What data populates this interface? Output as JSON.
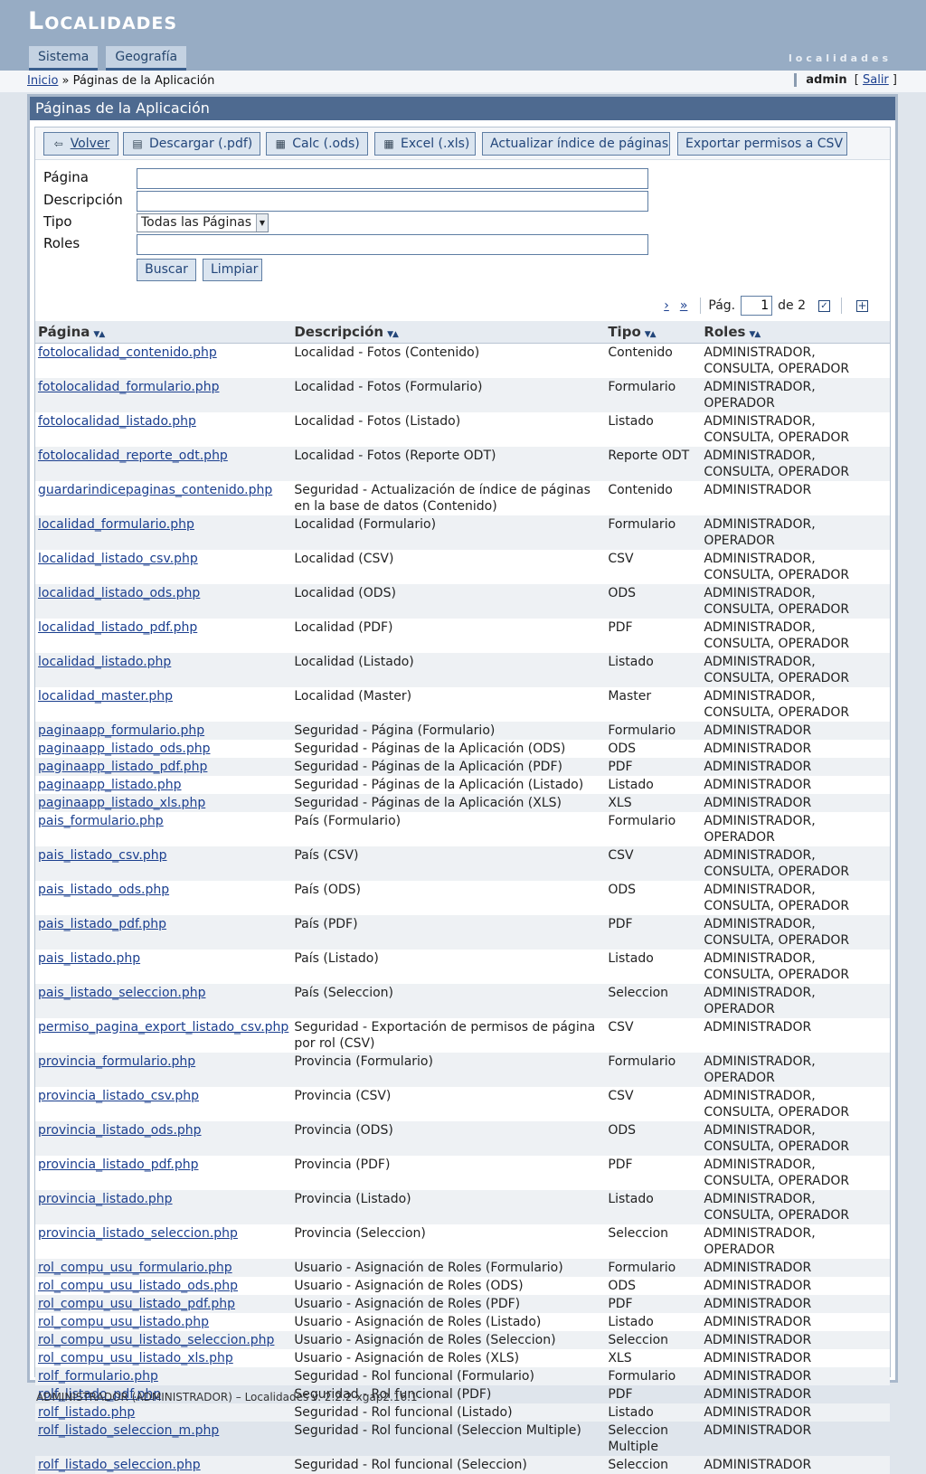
{
  "app": {
    "title": "Localidades",
    "tagline": "localidades"
  },
  "menu": {
    "tabs": [
      "Sistema",
      "Geografía"
    ]
  },
  "breadcrumb": {
    "home": "Inicio",
    "separator": "»",
    "current": "Páginas de la Aplicación"
  },
  "user": {
    "name": "admin",
    "logout": "Salir",
    "open": "[",
    "close": "]"
  },
  "panel": {
    "title": "Páginas de la Aplicación"
  },
  "toolbar": {
    "volver": "Volver",
    "pdf": "Descargar (.pdf)",
    "ods": "Calc (.ods)",
    "xls": "Excel (.xls)",
    "reindex": "Actualizar índice de páginas",
    "export": "Exportar permisos a CSV"
  },
  "form": {
    "pagina_label": "Página",
    "descripcion_label": "Descripción",
    "tipo_label": "Tipo",
    "roles_label": "Roles",
    "tipo_selected": "Todas las Páginas",
    "buscar": "Buscar",
    "limpiar": "Limpiar"
  },
  "pager": {
    "next": "›",
    "last": "»",
    "label": "Pág.",
    "current": "1",
    "of": "de 2"
  },
  "table": {
    "headers": [
      "Página",
      "Descripción",
      "Tipo",
      "Roles"
    ],
    "rows": [
      [
        "fotolocalidad_contenido.php",
        "Localidad - Fotos (Contenido)",
        "Contenido",
        "ADMINISTRADOR, CONSULTA, OPERADOR"
      ],
      [
        "fotolocalidad_formulario.php",
        "Localidad - Fotos (Formulario)",
        "Formulario",
        "ADMINISTRADOR, OPERADOR"
      ],
      [
        "fotolocalidad_listado.php",
        "Localidad - Fotos (Listado)",
        "Listado",
        "ADMINISTRADOR, CONSULTA, OPERADOR"
      ],
      [
        "fotolocalidad_reporte_odt.php",
        "Localidad - Fotos (Reporte ODT)",
        "Reporte ODT",
        "ADMINISTRADOR, CONSULTA, OPERADOR"
      ],
      [
        "guardarindicepaginas_contenido.php",
        "Seguridad - Actualización de índice de páginas en la base de datos (Contenido)",
        "Contenido",
        "ADMINISTRADOR"
      ],
      [
        "localidad_formulario.php",
        "Localidad (Formulario)",
        "Formulario",
        "ADMINISTRADOR, OPERADOR"
      ],
      [
        "localidad_listado_csv.php",
        "Localidad (CSV)",
        "CSV",
        "ADMINISTRADOR, CONSULTA, OPERADOR"
      ],
      [
        "localidad_listado_ods.php",
        "Localidad (ODS)",
        "ODS",
        "ADMINISTRADOR, CONSULTA, OPERADOR"
      ],
      [
        "localidad_listado_pdf.php",
        "Localidad (PDF)",
        "PDF",
        "ADMINISTRADOR, CONSULTA, OPERADOR"
      ],
      [
        "localidad_listado.php",
        "Localidad (Listado)",
        "Listado",
        "ADMINISTRADOR, CONSULTA, OPERADOR"
      ],
      [
        "localidad_master.php",
        "Localidad (Master)",
        "Master",
        "ADMINISTRADOR, CONSULTA, OPERADOR"
      ],
      [
        "paginaapp_formulario.php",
        "Seguridad - Página (Formulario)",
        "Formulario",
        "ADMINISTRADOR"
      ],
      [
        "paginaapp_listado_ods.php",
        "Seguridad - Páginas de la Aplicación (ODS)",
        "ODS",
        "ADMINISTRADOR"
      ],
      [
        "paginaapp_listado_pdf.php",
        "Seguridad - Páginas de la Aplicación (PDF)",
        "PDF",
        "ADMINISTRADOR"
      ],
      [
        "paginaapp_listado.php",
        "Seguridad - Páginas de la Aplicación (Listado)",
        "Listado",
        "ADMINISTRADOR"
      ],
      [
        "paginaapp_listado_xls.php",
        "Seguridad - Páginas de la Aplicación (XLS)",
        "XLS",
        "ADMINISTRADOR"
      ],
      [
        "pais_formulario.php",
        "País (Formulario)",
        "Formulario",
        "ADMINISTRADOR, OPERADOR"
      ],
      [
        "pais_listado_csv.php",
        "País (CSV)",
        "CSV",
        "ADMINISTRADOR, CONSULTA, OPERADOR"
      ],
      [
        "pais_listado_ods.php",
        "País (ODS)",
        "ODS",
        "ADMINISTRADOR, CONSULTA, OPERADOR"
      ],
      [
        "pais_listado_pdf.php",
        "País (PDF)",
        "PDF",
        "ADMINISTRADOR, CONSULTA, OPERADOR"
      ],
      [
        "pais_listado.php",
        "País (Listado)",
        "Listado",
        "ADMINISTRADOR, CONSULTA, OPERADOR"
      ],
      [
        "pais_listado_seleccion.php",
        "País (Seleccion)",
        "Seleccion",
        "ADMINISTRADOR, OPERADOR"
      ],
      [
        "permiso_pagina_export_listado_csv.php",
        "Seguridad - Exportación de permisos de página por rol (CSV)",
        "CSV",
        "ADMINISTRADOR"
      ],
      [
        "provincia_formulario.php",
        "Provincia (Formulario)",
        "Formulario",
        "ADMINISTRADOR, OPERADOR"
      ],
      [
        "provincia_listado_csv.php",
        "Provincia (CSV)",
        "CSV",
        "ADMINISTRADOR, CONSULTA, OPERADOR"
      ],
      [
        "provincia_listado_ods.php",
        "Provincia (ODS)",
        "ODS",
        "ADMINISTRADOR, CONSULTA, OPERADOR"
      ],
      [
        "provincia_listado_pdf.php",
        "Provincia (PDF)",
        "PDF",
        "ADMINISTRADOR, CONSULTA, OPERADOR"
      ],
      [
        "provincia_listado.php",
        "Provincia (Listado)",
        "Listado",
        "ADMINISTRADOR, CONSULTA, OPERADOR"
      ],
      [
        "provincia_listado_seleccion.php",
        "Provincia (Seleccion)",
        "Seleccion",
        "ADMINISTRADOR, OPERADOR"
      ],
      [
        "rol_compu_usu_formulario.php",
        "Usuario - Asignación de Roles (Formulario)",
        "Formulario",
        "ADMINISTRADOR"
      ],
      [
        "rol_compu_usu_listado_ods.php",
        "Usuario - Asignación de Roles (ODS)",
        "ODS",
        "ADMINISTRADOR"
      ],
      [
        "rol_compu_usu_listado_pdf.php",
        "Usuario - Asignación de Roles (PDF)",
        "PDF",
        "ADMINISTRADOR"
      ],
      [
        "rol_compu_usu_listado.php",
        "Usuario - Asignación de Roles (Listado)",
        "Listado",
        "ADMINISTRADOR"
      ],
      [
        "rol_compu_usu_listado_seleccion.php",
        "Usuario - Asignación de Roles (Seleccion)",
        "Seleccion",
        "ADMINISTRADOR"
      ],
      [
        "rol_compu_usu_listado_xls.php",
        "Usuario - Asignación de Roles (XLS)",
        "XLS",
        "ADMINISTRADOR"
      ],
      [
        "rolf_formulario.php",
        "Seguridad - Rol funcional (Formulario)",
        "Formulario",
        "ADMINISTRADOR"
      ],
      [
        "rolf_listado_pdf.php",
        "Seguridad - Rol funcional (PDF)",
        "PDF",
        "ADMINISTRADOR"
      ],
      [
        "rolf_listado.php",
        "Seguridad - Rol funcional (Listado)",
        "Listado",
        "ADMINISTRADOR"
      ],
      [
        "rolf_listado_seleccion_m.php",
        "Seguridad - Rol funcional (Seleccion Multiple)",
        "Seleccion Multiple",
        "ADMINISTRADOR"
      ],
      [
        "rolf_listado_seleccion.php",
        "Seguridad - Rol funcional (Seleccion)",
        "Seleccion",
        "ADMINISTRADOR"
      ]
    ]
  },
  "footer": {
    "text": "ADMINISTRADOR (ADMINISTRADOR)  –  Localidades v. 2.2.2-xgap2.16.1"
  },
  "icons": {
    "volver": "back-arrow-icon",
    "pdf": "document-icon",
    "ods": "spreadsheet-icon",
    "xls": "spreadsheet-icon",
    "sort": "sort-arrows-icon",
    "select_all": "checkbox-icon",
    "expand": "plus-box-icon",
    "dropdown": "chevron-down-icon"
  }
}
